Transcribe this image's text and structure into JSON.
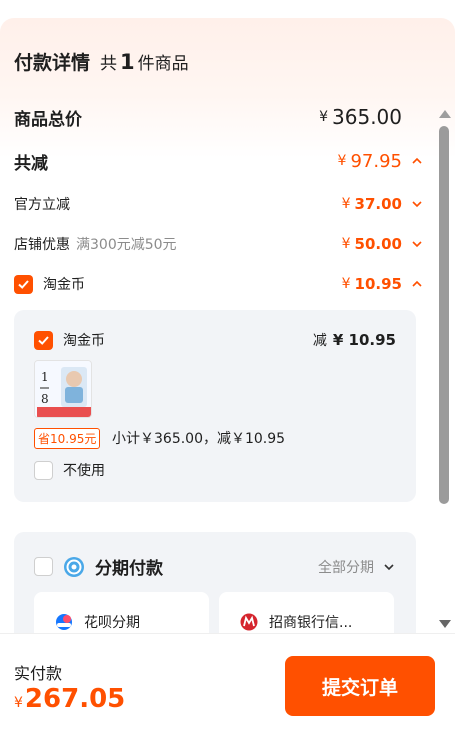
{
  "header": {
    "title": "付款详情",
    "count_prefix": "共",
    "count": "1",
    "count_suffix": "件商品"
  },
  "summary": {
    "total": {
      "label": "商品总价",
      "currency": "¥",
      "value": "365.00"
    },
    "discount": {
      "label": "共减",
      "currency": "¥",
      "value": "97.95",
      "icon": "chevron-up-icon"
    },
    "official": {
      "label": "官方立减",
      "currency": "¥",
      "value": "37.00",
      "icon": "chevron-down-icon"
    },
    "store": {
      "label": "店铺优惠",
      "note": "满300元减50元",
      "currency": "¥",
      "value": "50.00",
      "icon": "chevron-down-icon"
    },
    "coin": {
      "label": "淘金币",
      "currency": "¥",
      "value": "10.95",
      "checked": true,
      "icon": "chevron-up-icon"
    }
  },
  "coin_card": {
    "label": "淘金币",
    "minus_label": "减",
    "minus_value": "¥ 10.95",
    "save_tag": "省10.95元",
    "subtotal": "小计￥365.00，减￥10.95",
    "not_use_label": "不使用",
    "thumb_text": {
      "top": "1",
      "bottom": "8"
    }
  },
  "installment": {
    "title": "分期付款",
    "all_label": "全部分期",
    "options": [
      {
        "label": "花呗分期",
        "icon": "huabei-icon"
      },
      {
        "label": "招商银行信...",
        "icon": "cmb-bank-icon"
      }
    ]
  },
  "footer": {
    "pay_label": "实付款",
    "currency": "¥",
    "pay_value": "267.05",
    "submit_label": "提交订单"
  },
  "colors": {
    "accent": "#ff5000",
    "text": "#1f1f1f",
    "muted": "#8c8c8c",
    "card": "#f2f4f7"
  }
}
